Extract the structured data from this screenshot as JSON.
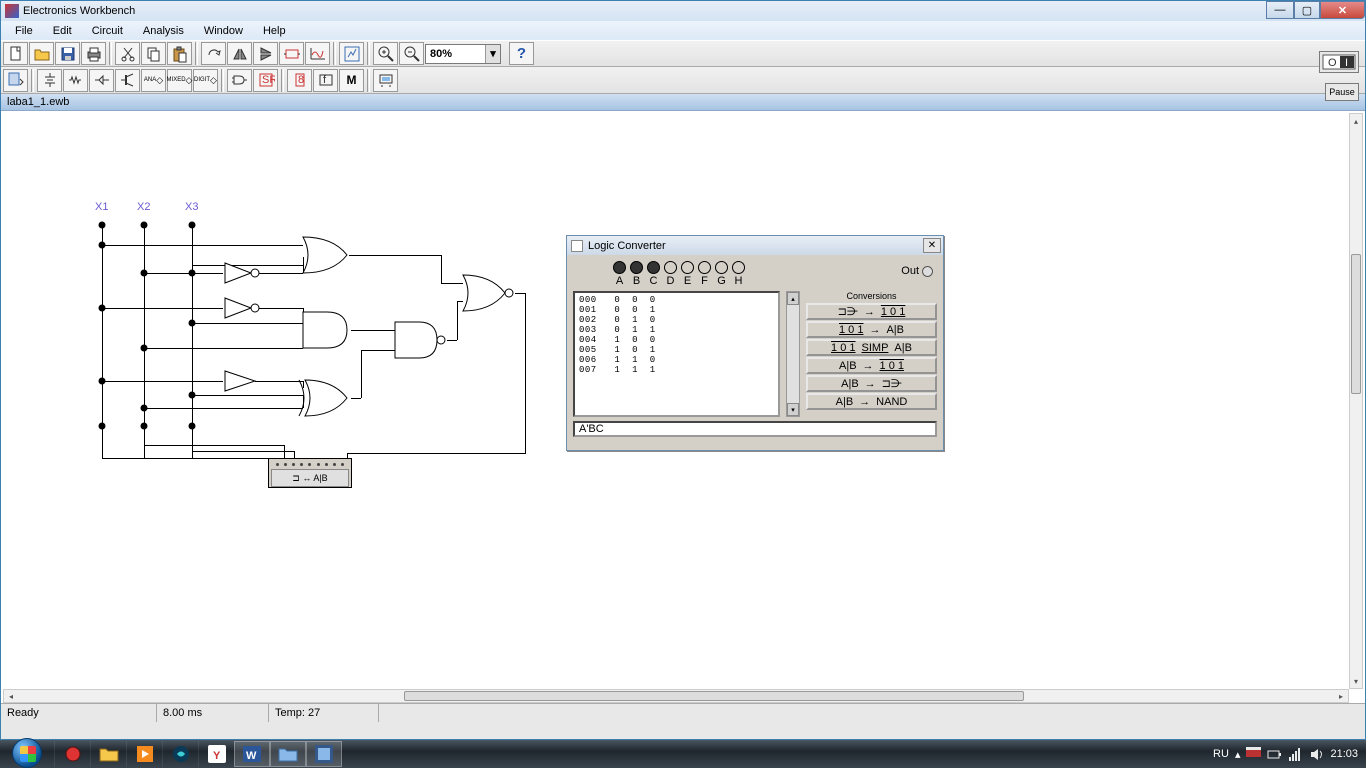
{
  "window": {
    "title": "Electronics Workbench"
  },
  "menu": {
    "file": "File",
    "edit": "Edit",
    "circuit": "Circuit",
    "analysis": "Analysis",
    "window": "Window",
    "help": "Help"
  },
  "toolbar": {
    "zoom": "80%",
    "pause": "Pause"
  },
  "document": {
    "name": "laba1_1.ewb"
  },
  "circuit": {
    "labels": {
      "x1": "X1",
      "x2": "X2",
      "x3": "X3"
    }
  },
  "logic_converter": {
    "title": "Logic Converter",
    "input_labels": [
      "A",
      "B",
      "C",
      "D",
      "E",
      "F",
      "G",
      "H"
    ],
    "out_label": "Out",
    "truth_rows": [
      {
        "i": "000",
        "a": "0",
        "b": "0",
        "c": "0",
        "out": "0"
      },
      {
        "i": "001",
        "a": "0",
        "b": "0",
        "c": "1",
        "out": "0"
      },
      {
        "i": "002",
        "a": "0",
        "b": "1",
        "c": "0",
        "out": "0"
      },
      {
        "i": "003",
        "a": "0",
        "b": "1",
        "c": "1",
        "out": "1"
      },
      {
        "i": "004",
        "a": "1",
        "b": "0",
        "c": "0",
        "out": "0"
      },
      {
        "i": "005",
        "a": "1",
        "b": "0",
        "c": "1",
        "out": "0"
      },
      {
        "i": "006",
        "a": "1",
        "b": "1",
        "c": "0",
        "out": "0"
      },
      {
        "i": "007",
        "a": "1",
        "b": "1",
        "c": "1",
        "out": "0"
      }
    ],
    "conversions_header": "Conversions",
    "buttons": {
      "b1_left": "⊐⋺",
      "b1_arrow": "→",
      "b1_right": "1 0 1",
      "b2_left": "1 0 1",
      "b2_arrow": "→",
      "b2_right": "A|B",
      "b3_left": "1 0 1",
      "b3_mid": "SIMP",
      "b3_right": "A|B",
      "b4_left": "A|B",
      "b4_arrow": "→",
      "b4_right": "1 0 1",
      "b5_left": "A|B",
      "b5_arrow": "→",
      "b5_right": "⊐⋺",
      "b6_left": "A|B",
      "b6_arrow": "→",
      "b6_right": "NAND"
    },
    "expression": "A'BC"
  },
  "lc_instrument": {
    "label": "⊐ ↔ A|B"
  },
  "status": {
    "ready": "Ready",
    "time": "8.00 ms",
    "temp": "Temp: 27"
  },
  "taskbar": {
    "lang": "RU",
    "clock": "21:03"
  }
}
